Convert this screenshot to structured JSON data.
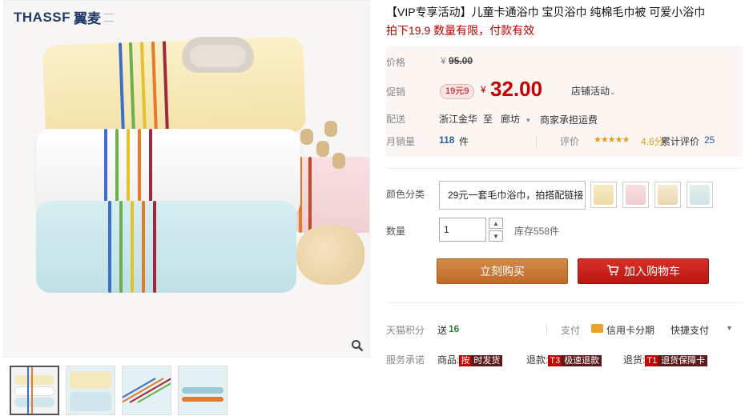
{
  "brand": {
    "logo": "THASSF",
    "logo_cn": "翼麦"
  },
  "gallery": {
    "zoom_icon": "zoom-icon",
    "thumbnails": [
      {
        "label": "thumb-1",
        "active": true
      },
      {
        "label": "thumb-2",
        "active": false
      },
      {
        "label": "thumb-3",
        "active": false
      },
      {
        "label": "thumb-4",
        "active": false
      }
    ]
  },
  "product": {
    "title": "【VIP专享活动】儿童卡通浴巾 宝贝浴巾 纯棉毛巾被 可爱小浴巾",
    "subtitle": "拍下19.9 数量有限，付款有效"
  },
  "price": {
    "label": "价格",
    "currency": "¥",
    "original": "95.00",
    "promo_label": "促销",
    "promo_tag": "19元9",
    "promo_price": "32.00",
    "store_activity": "店铺活动"
  },
  "shipping": {
    "label": "配送",
    "from": "浙江金华",
    "to_word": "至",
    "to": "廊坊",
    "note": "商家承担运费"
  },
  "sales": {
    "label": "月销量",
    "count": "118",
    "unit": "件",
    "review_label": "评价",
    "rating": "4.6分",
    "review_text": "累计评价",
    "review_count": "25"
  },
  "sku": {
    "label": "颜色分类",
    "selected": "29元一套毛巾浴巾，拍搭配链接"
  },
  "quantity": {
    "label": "数量",
    "value": "1",
    "stock": "库存558件"
  },
  "buttons": {
    "buy": "立刻购买",
    "cart": "加入购物车"
  },
  "points": {
    "label": "天猫积分",
    "give": "送",
    "amount": "16",
    "pay_label": "支付",
    "card": "信用卡分期",
    "quick": "快捷支付"
  },
  "services": {
    "label": "服务承诺",
    "item1": "商品:",
    "tag1a": "按",
    "tag1b": "时发货",
    "item2": "退款:",
    "tag2a": "T3",
    "tag2b": "极速退款",
    "item3": "退货:",
    "tag3a": "T1",
    "tag3b": "退货保障卡"
  },
  "colors": {
    "price_red": "#c40000",
    "buy_button": "#c8762f",
    "cart_button": "#c8201a",
    "link_blue": "#2a5ea6"
  }
}
